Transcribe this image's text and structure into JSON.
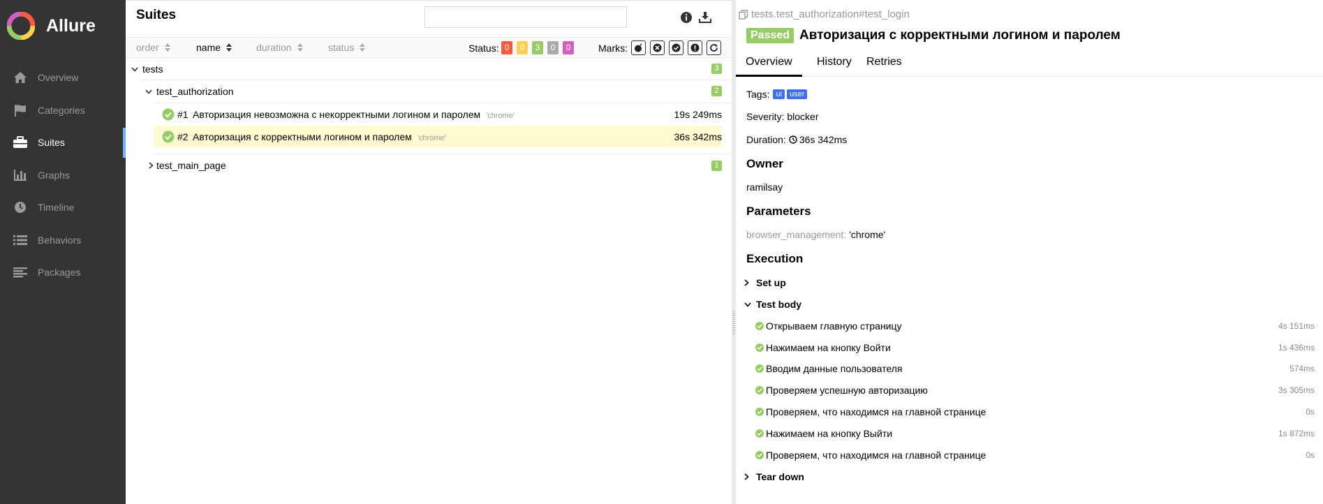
{
  "brand": {
    "name": "Allure"
  },
  "sidebar": {
    "items": [
      {
        "label": "Overview",
        "icon": "home-icon"
      },
      {
        "label": "Categories",
        "icon": "flag-icon"
      },
      {
        "label": "Suites",
        "icon": "briefcase-icon",
        "active": true
      },
      {
        "label": "Graphs",
        "icon": "bar-chart-icon"
      },
      {
        "label": "Timeline",
        "icon": "clock-icon"
      },
      {
        "label": "Behaviors",
        "icon": "list-icon"
      },
      {
        "label": "Packages",
        "icon": "align-left-icon"
      }
    ]
  },
  "suites": {
    "title": "Suites",
    "search": {
      "value": "",
      "placeholder": ""
    },
    "sort": {
      "order": "order",
      "name": "name",
      "duration": "duration",
      "status": "status"
    },
    "status_label": "Status:",
    "status_counts": [
      {
        "value": "0",
        "color": "#fd5a3e"
      },
      {
        "value": "0",
        "color": "#ffd050"
      },
      {
        "value": "3",
        "color": "#97cc64"
      },
      {
        "value": "0",
        "color": "#aaaaaa"
      },
      {
        "value": "0",
        "color": "#d35ebe"
      }
    ],
    "marks_label": "Marks:",
    "tree": {
      "root": {
        "name": "tests",
        "count": "3"
      },
      "group1": {
        "name": "test_authorization",
        "count": "2"
      },
      "tests": [
        {
          "num": "#1",
          "name": "Авторизация невозможна с некорректными логином и паролем",
          "param": "'chrome'",
          "duration": "19s 249ms"
        },
        {
          "num": "#2",
          "name": "Авторизация с корректными логином и паролем",
          "param": "'chrome'",
          "duration": "36s 342ms"
        }
      ],
      "group2": {
        "name": "test_main_page",
        "count": "1"
      }
    }
  },
  "detail": {
    "breadcrumb": "tests.test_authorization#test_login",
    "status": "Passed",
    "title": "Авторизация с корректными логином и паролем",
    "tabs": [
      "Overview",
      "History",
      "Retries"
    ],
    "tags_label": "Tags:",
    "tags": [
      "ui",
      "user"
    ],
    "severity": "Severity: blocker",
    "duration_label": "Duration:",
    "duration": "36s 342ms",
    "owner_title": "Owner",
    "owner": "ramilsay",
    "params_title": "Parameters",
    "param_key": "browser_management:",
    "param_value": "'chrome'",
    "exec_title": "Execution",
    "setup": "Set up",
    "body": "Test body",
    "steps": [
      {
        "name": "Открываем главную страницу",
        "duration": "4s 151ms"
      },
      {
        "name": "Нажимаем на кнопку Войти",
        "duration": "1s 436ms"
      },
      {
        "name": "Вводим данные пользователя",
        "duration": "574ms"
      },
      {
        "name": "Проверяем успешную авторизацию",
        "duration": "3s 305ms"
      },
      {
        "name": "Проверяем, что находимся на главной странице",
        "duration": "0s"
      },
      {
        "name": "Нажимаем на кнопку Выйти",
        "duration": "1s 872ms"
      },
      {
        "name": "Проверяем, что находимся на главной странице",
        "duration": "0s"
      }
    ],
    "teardown": "Tear down"
  },
  "colors": {
    "passed": "#97cc64",
    "sidebar": "#343434",
    "selected_row": "#fffbd1",
    "tag": "#3d6ef4"
  }
}
